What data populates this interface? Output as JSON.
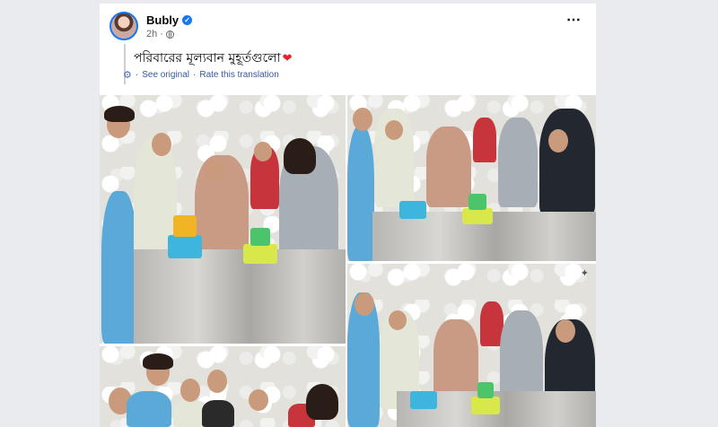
{
  "post": {
    "author": "Bubly",
    "time": "2h",
    "caption": "পরিবারের মূল্যবান মুহূর্তগুলো",
    "caption_emoji": "❤",
    "see_original": "See original",
    "separator": "·",
    "rate_translation": "Rate this translation",
    "more_icon": "⋯"
  },
  "icons": {
    "verified": "verified-badge-icon",
    "audience": "globe-icon",
    "translate": "gear-icon",
    "more": "more-options-icon"
  },
  "colors": {
    "page_bg": "#e9ebee",
    "link": "#385898",
    "verified": "#1877f2",
    "heart": "#e0232d"
  },
  "photos": [
    {
      "label": "family-photo-1"
    },
    {
      "label": "family-photo-2"
    },
    {
      "label": "family-photo-3"
    },
    {
      "label": "family-photo-4"
    },
    {
      "label": "family-photo-5"
    }
  ]
}
